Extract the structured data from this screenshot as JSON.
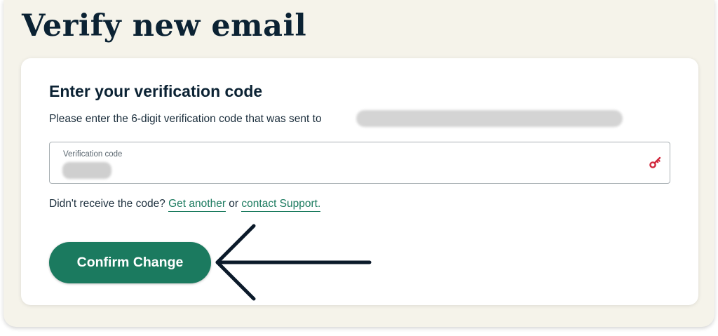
{
  "page": {
    "title": "Verify new email"
  },
  "card": {
    "heading": "Enter your verification code",
    "instruction": "Please enter the 6-digit verification code that was sent to",
    "code_field": {
      "label": "Verification code",
      "value": "",
      "icon": "key-icon"
    },
    "resend": {
      "prefix": "Didn't receive the code?",
      "get_another_label": "Get another",
      "separator": "or",
      "support_label": "contact Support."
    },
    "confirm_button_label": "Confirm Change"
  },
  "annotation": {
    "type": "arrow",
    "points_to": "confirm-button",
    "color": "#0b1a2a"
  },
  "colors": {
    "brand_green": "#1b7a5f",
    "link_green": "#1a7a5e",
    "key_icon_red": "#d1263b",
    "panel_background": "#f5f3ea",
    "title_color": "#0b2233"
  }
}
